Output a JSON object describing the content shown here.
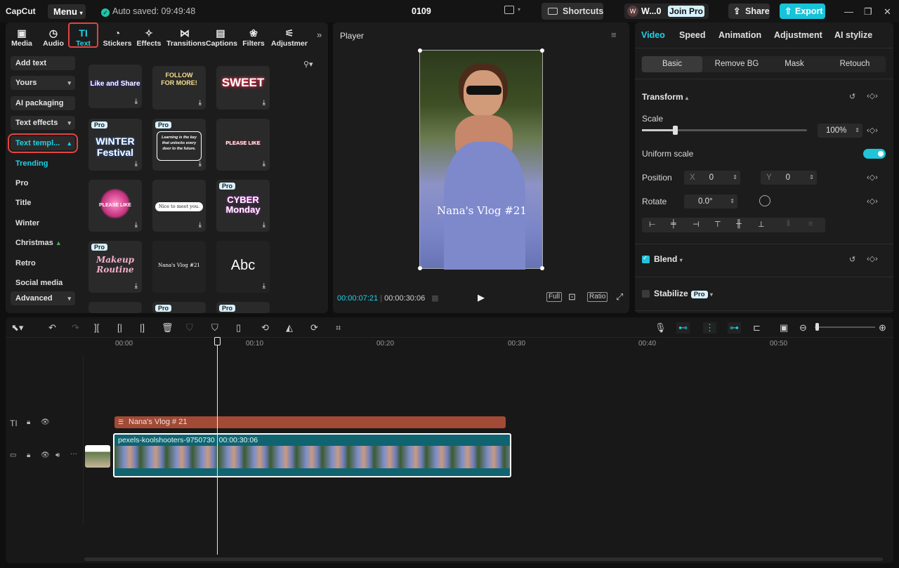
{
  "topbar": {
    "logo": "CapCut",
    "menu": "Menu",
    "autosave": "Auto saved: 09:49:48",
    "project": "0109",
    "shortcuts": "Shortcuts",
    "workspace_avatar": "W",
    "workspace": "W...0",
    "join_pro": "Join Pro",
    "share": "Share",
    "export": "Export"
  },
  "toolbar": {
    "tabs": [
      {
        "label": "Media",
        "icon": "media-icon"
      },
      {
        "label": "Audio",
        "icon": "audio-icon"
      },
      {
        "label": "Text",
        "icon": "text-icon",
        "active": true
      },
      {
        "label": "Stickers",
        "icon": "stickers-icon"
      },
      {
        "label": "Effects",
        "icon": "effects-icon"
      },
      {
        "label": "Transitions",
        "icon": "transitions-icon"
      },
      {
        "label": "Captions",
        "icon": "captions-icon"
      },
      {
        "label": "Filters",
        "icon": "filters-icon"
      },
      {
        "label": "Adjustmen",
        "icon": "adjustment-icon"
      }
    ]
  },
  "sidebar": {
    "add_text": "Add text",
    "yours": "Yours",
    "ai_packaging": "AI packaging",
    "text_effects": "Text effects",
    "text_templates": "Text templ...",
    "subitems": [
      "Trending",
      "Pro",
      "Title",
      "Winter",
      "Christmas",
      "Retro",
      "Social media"
    ],
    "advanced": "Advanced"
  },
  "templates": [
    {
      "art": "Like and Share",
      "pro": ""
    },
    {
      "art": "FOLLOW FOR MORE!",
      "pro": ""
    },
    {
      "art": "SWEET",
      "pro": ""
    },
    {
      "art": "WINTER Festival",
      "pro": "Pro"
    },
    {
      "art": "Learning is the key that unlocks every door to the future.",
      "pro": "Pro"
    },
    {
      "art": "PLEASE LIKE",
      "pro": ""
    },
    {
      "art": "PLEASE LIKE",
      "pro": ""
    },
    {
      "art": "Nice to meet you.",
      "pro": ""
    },
    {
      "art": "CYBER Monday",
      "pro": "Pro"
    },
    {
      "art": "Makeup Routine",
      "pro": "Pro"
    },
    {
      "art": "Nana's Vlog #21",
      "pro": ""
    },
    {
      "art": "Abc",
      "pro": ""
    }
  ],
  "player": {
    "title": "Player",
    "overlay_text": "Nana's Vlog #21",
    "current_time": "00:00:07:21",
    "duration": "00:00:30:06",
    "full": "Full",
    "ratio": "Ratio"
  },
  "inspector": {
    "tabs": [
      "Video",
      "Speed",
      "Animation",
      "Adjustment",
      "AI stylize"
    ],
    "subtabs": [
      "Basic",
      "Remove BG",
      "Mask",
      "Retouch"
    ],
    "transform": "Transform",
    "scale_label": "Scale",
    "scale_value": "100%",
    "scale_fraction": 0.2,
    "uniform_scale": "Uniform scale",
    "position_label": "Position",
    "x_label": "X",
    "x_value": "0",
    "y_label": "Y",
    "y_value": "0",
    "rotate_label": "Rotate",
    "rotate_value": "0.0°",
    "blend": "Blend",
    "stabilize": "Stabilize",
    "pro": "Pro"
  },
  "timeline": {
    "ruler": [
      "00:00",
      "00:10",
      "00:20",
      "00:30",
      "00:40",
      "00:50"
    ],
    "text_clip": "Nana's  Vlog  # 21",
    "video_clip_name": "pexels-koolshooters-9750730",
    "video_clip_duration": "00:00:30:06"
  },
  "colors": {
    "accent": "#1dd3e6",
    "highlight": "#e2453f",
    "text_clip": "#a24a35",
    "video_clip": "#0f6470"
  }
}
